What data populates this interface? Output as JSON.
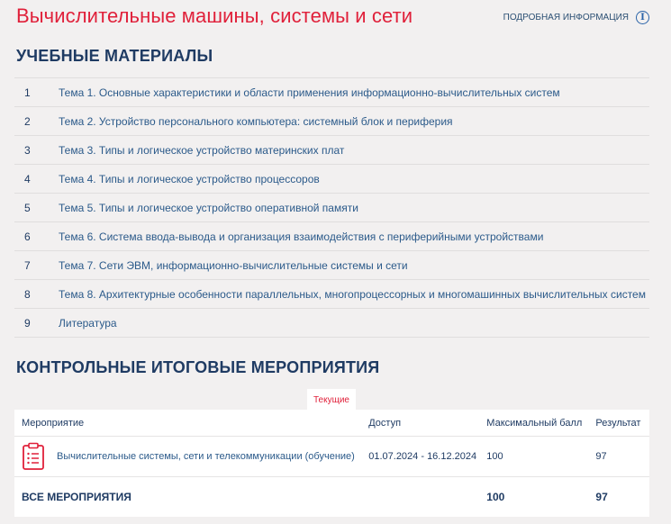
{
  "header": {
    "title": "Вычислительные машины, системы и сети",
    "info_label": "ПОДРОБНАЯ ИНФОРМАЦИЯ",
    "info_icon": "info-icon"
  },
  "materials": {
    "title": "УЧЕБНЫЕ МАТЕРИАЛЫ",
    "items": [
      {
        "num": "1",
        "label": "Тема 1. Основные характеристики и области применения информационно-вычислительных систем"
      },
      {
        "num": "2",
        "label": "Тема 2. Устройство персонального компьютера: системный блок и периферия"
      },
      {
        "num": "3",
        "label": "Тема 3. Типы и логическое устройство материнских плат"
      },
      {
        "num": "4",
        "label": "Тема 4. Типы и логическое устройство процессоров"
      },
      {
        "num": "5",
        "label": "Тема 5. Типы и логическое устройство оперативной памяти"
      },
      {
        "num": "6",
        "label": "Тема 6. Система ввода-вывода и организация взаимодействия с периферийными устройствами"
      },
      {
        "num": "7",
        "label": "Тема 7. Сети ЭВМ, информационно-вычислительные системы и сети"
      },
      {
        "num": "8",
        "label": "Тема 8. Архитектурные особенности параллельных, многопроцессорных и многомашинных вычислительных систем"
      },
      {
        "num": "9",
        "label": "Литература"
      }
    ]
  },
  "events": {
    "title": "КОНТРОЛЬНЫЕ ИТОГОВЫЕ МЕРОПРИЯТИЯ",
    "tab_current": "Текущие",
    "columns": {
      "event": "Мероприятие",
      "access": "Доступ",
      "max": "Максимальный балл",
      "result": "Результат"
    },
    "rows": [
      {
        "icon": "clipboard-icon",
        "name": "Вычислительные системы, сети и телекоммуникации (обучение)",
        "access": "01.07.2024 - 16.12.2024",
        "max": "100",
        "result": "97"
      }
    ],
    "total": {
      "label": "ВСЕ МЕРОПРИЯТИЯ",
      "max": "100",
      "result": "97"
    }
  },
  "colors": {
    "accent": "#e0203a",
    "text": "#1f3b63",
    "link": "#2b5a8a",
    "background": "#f2f0f0"
  }
}
